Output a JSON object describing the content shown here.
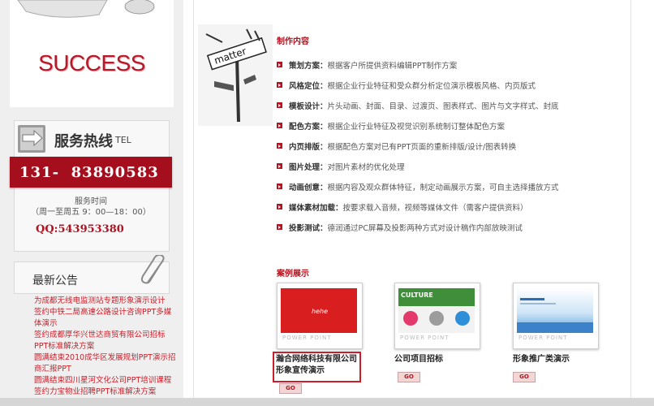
{
  "sidebar": {
    "success_text": "SUCCESS",
    "hotline": {
      "title": "服务热线",
      "tel_label": "TEL",
      "phone": "131-  83890583",
      "hours_label": "服务时间",
      "hours": "（周一至周五 9：00—18：00）",
      "qq": "QQ:543953380"
    },
    "notice": {
      "title": "最新公告",
      "items": [
        "为成都无线电监测站专题形象演示设计",
        "签约中铁二局高速公路设计咨询PPT多媒体演示",
        "签约成都厚华兴世达商贸有限公司招标PPT标准解决方案",
        "圆满结束2010成华区发展规划PPT演示招商汇报PPT",
        "圆满结束四川星河文化公司PPT培训课程",
        "签约力宝物业招聘PPT标准解决方案"
      ]
    }
  },
  "main": {
    "sign_text": "matter",
    "make_title": "制作内容",
    "make_items": [
      {
        "label": "策划方案：",
        "desc": "根据客户所提供资料编辑PPT制作方案"
      },
      {
        "label": "风格定位：",
        "desc": "根据企业行业特征和受众群分析定位演示模板风格、内页版式"
      },
      {
        "label": "模板设计：",
        "desc": "片头动画、封面、目录、过渡页、图表样式、图片与文字样式、封底"
      },
      {
        "label": "配色方案：",
        "desc": "根据企业行业特征及视觉识别系统制订整体配色方案"
      },
      {
        "label": "内页排版：",
        "desc": "根据配色方案对已有PPT页面的重新排版/设计/图表转换"
      },
      {
        "label": "图片处理：",
        "desc": "对图片素材的优化处理"
      },
      {
        "label": "动画创意：",
        "desc": "根据内容及观众群体特征，制定动画展示方案，可自主选择播放方式"
      },
      {
        "label": "媒体素材加载：",
        "desc": "按要求载入音频，视频等媒体文件（需客户提供资料）"
      },
      {
        "label": "投影测试：",
        "desc": "德润通过PC屏幕及投影两种方式对设计稿作内部放映测试"
      }
    ],
    "case_title": "案例展示",
    "cases": [
      {
        "name_line1": "瀚合网络科技有限公司",
        "name_line2": "形象宣传演示",
        "thumb_text": "hehe",
        "power": "POWER POINT",
        "go": "GO"
      },
      {
        "name_line1": "公司项目招标",
        "name_line2": "",
        "thumb_text": "CULTURE",
        "power": "POWER POINT",
        "go": "GO"
      },
      {
        "name_line1": "形象推广类演示",
        "name_line2": "",
        "thumb_text": "",
        "power": "POWER POINT",
        "go": "GO"
      }
    ]
  },
  "colors": {
    "accent": "#b6121f",
    "phone_bar": "#a50f1d",
    "link": "#cc1e2a"
  }
}
